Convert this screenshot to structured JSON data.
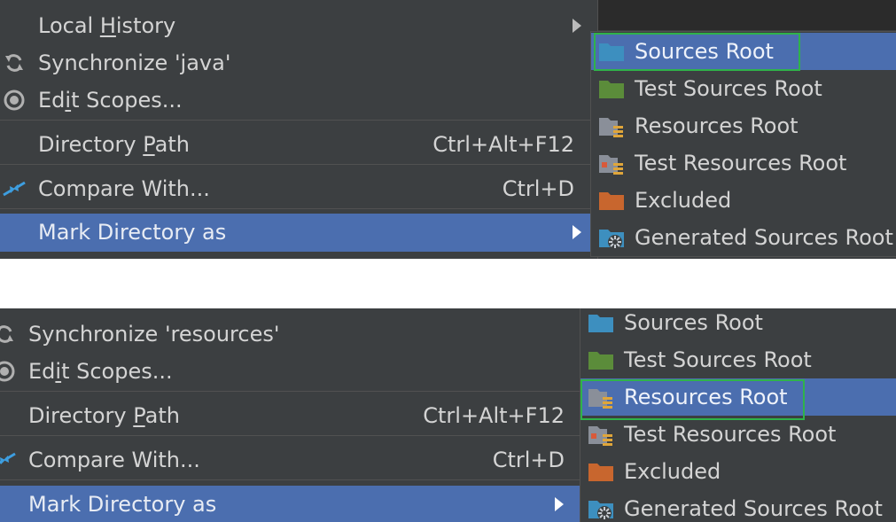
{
  "menus": [
    {
      "items": [
        {
          "label_pre": "Local ",
          "label_u": "H",
          "label_post": "istory",
          "icon": "none",
          "submenu": true
        },
        {
          "label": "Synchronize 'java'",
          "icon": "sync-icon"
        },
        {
          "label_pre": "Ed",
          "label_u": "i",
          "label_post": "t Scopes...",
          "icon": "scope-icon"
        },
        {
          "label_pre": "Directory ",
          "label_u": "P",
          "label_post": "ath",
          "shortcut": "Ctrl+Alt+F12"
        },
        {
          "label": "Compare With...",
          "icon": "compare-icon",
          "shortcut": "Ctrl+D"
        },
        {
          "label": "Mark Directory as",
          "selected": true,
          "submenu": true
        }
      ],
      "submenu": [
        {
          "label": "Sources Root",
          "icon": "sources-root-folder-icon",
          "color": "#3d8fbf",
          "selected": true,
          "highlighted": true
        },
        {
          "label": "Test Sources Root",
          "icon": "test-sources-root-folder-icon",
          "color": "#5b8c3a"
        },
        {
          "label": "Resources Root",
          "icon": "resources-root-folder-icon",
          "color": "#8a8f99"
        },
        {
          "label": "Test Resources Root",
          "icon": "test-resources-root-folder-icon",
          "color": "#8a8f99"
        },
        {
          "label": "Excluded",
          "icon": "excluded-folder-icon",
          "color": "#c8662e"
        },
        {
          "label": "Generated Sources Root",
          "icon": "generated-sources-root-folder-icon",
          "color": "#3d8fbf"
        }
      ]
    },
    {
      "items": [
        {
          "label": "Synchronize 'resources'",
          "icon": "sync-icon"
        },
        {
          "label_pre": "Ed",
          "label_u": "i",
          "label_post": "t Scopes...",
          "icon": "scope-icon"
        },
        {
          "label_pre": "Directory ",
          "label_u": "P",
          "label_post": "ath",
          "shortcut": "Ctrl+Alt+F12"
        },
        {
          "label": "Compare With...",
          "icon": "compare-icon",
          "shortcut": "Ctrl+D"
        },
        {
          "label": "Mark Directory as",
          "selected": true,
          "submenu": true
        }
      ],
      "submenu": [
        {
          "label": "Sources Root",
          "icon": "sources-root-folder-icon",
          "color": "#3d8fbf"
        },
        {
          "label": "Test Sources Root",
          "icon": "test-sources-root-folder-icon",
          "color": "#5b8c3a"
        },
        {
          "label": "Resources Root",
          "icon": "resources-root-folder-icon",
          "color": "#8a8f99",
          "selected": true,
          "highlighted": true
        },
        {
          "label": "Test Resources Root",
          "icon": "test-resources-root-folder-icon",
          "color": "#8a8f99"
        },
        {
          "label": "Excluded",
          "icon": "excluded-folder-icon",
          "color": "#c8662e"
        },
        {
          "label": "Generated Sources Root",
          "icon": "generated-sources-root-folder-icon",
          "color": "#3d8fbf"
        }
      ]
    }
  ],
  "colors": {
    "menu_bg": "#3c3f41",
    "selection": "#4b6eaf",
    "highlight_border": "#2fb34a",
    "icon_blue": "#3d8fbf"
  }
}
